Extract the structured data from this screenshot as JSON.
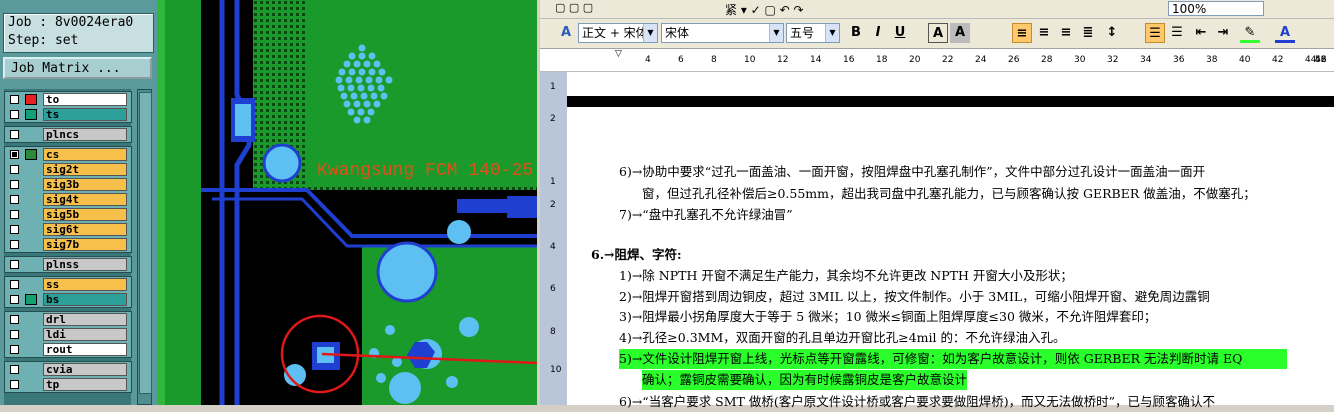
{
  "left_panel": {
    "job_label": "Job : 8v0024era0",
    "step_label": "Step: set",
    "job_matrix_button": "Job Matrix ...",
    "layers": [
      {
        "name": "to",
        "color": "#e82020",
        "selected": false
      },
      {
        "name": "ts",
        "color": "#12a07a",
        "selected": false
      },
      {
        "name": "plncs",
        "color": "",
        "selected": false
      },
      {
        "name": "cs",
        "color": "#2a8a3a",
        "selected": true
      },
      {
        "name": "sig2t",
        "color": "",
        "selected": false
      },
      {
        "name": "sig3b",
        "color": "",
        "selected": false
      },
      {
        "name": "sig4t",
        "color": "",
        "selected": false
      },
      {
        "name": "sig5b",
        "color": "",
        "selected": false
      },
      {
        "name": "sig6t",
        "color": "",
        "selected": false
      },
      {
        "name": "sig7b",
        "color": "",
        "selected": false
      },
      {
        "name": "plnss",
        "color": "",
        "selected": false
      },
      {
        "name": "ss",
        "color": "",
        "selected": false
      },
      {
        "name": "bs",
        "color": "#14a070",
        "selected": false
      },
      {
        "name": "drl",
        "color": "",
        "selected": false
      },
      {
        "name": "ldi",
        "color": "",
        "selected": false
      },
      {
        "name": "rout",
        "color": "",
        "selected": false
      },
      {
        "name": "cvia",
        "color": "",
        "selected": false
      },
      {
        "name": "tp",
        "color": "",
        "selected": false
      }
    ]
  },
  "pcb_view": {
    "silkscreen_text": "Kwangsung FCM 140-25",
    "colors": {
      "board": "#1a9a2a",
      "trace": "#1e3fd0",
      "pad": "#5ec0f2",
      "annotation": "#e01818"
    }
  },
  "word": {
    "style_combo": "正文 + 宋体",
    "font_combo": "宋体",
    "size_combo": "五号",
    "zoom": "100%",
    "ruler_numbers": [
      "4",
      "6",
      "8",
      "10",
      "12",
      "14",
      "16",
      "18",
      "20",
      "22",
      "24",
      "26",
      "28",
      "30",
      "32",
      "34",
      "36",
      "38",
      "40",
      "42",
      "44",
      "46",
      "48",
      "52"
    ],
    "vruler_numbers": [
      "1",
      "2",
      "1",
      "2",
      "4",
      "6",
      "8",
      "10"
    ],
    "paragraphs": {
      "p6_line1": "6)→协助中要求“过孔一面盖油、一面开窗，按阻焊盘中孔塞孔制作”，文件中部分过孔设计一面盖油一面开",
      "p6_line2": "窗，但过孔孔径补偿后≥0.55mm，超出我司盘中孔塞孔能力，已与顾客确认按 GERBER 做盖油，不做塞孔；",
      "p7": "7)→“盘中孔塞孔不允许绿油冒”",
      "heading": "6.→阻焊、字符:",
      "s1": "1)→除 NPTH 开窗不满足生产能力，其余均不允许更改 NPTH 开窗大小及形状；",
      "s2": "2)→阻焊开窗搭到周边铜皮，超过 3MIL 以上，按文件制作。小于 3MIL，可缩小阻焊开窗、避免周边露铜",
      "s3": "3)→阻焊最小拐角厚度大于等于 5 微米；10 微米≤铜面上阻焊厚度≤30 微米，不允许阻焊套印；",
      "s4": "4)→孔径≥0.3MM，双面开窗的孔且单边开窗比孔≥4mil 的：不允许绿油入孔。",
      "s5_line1": "5)→文件设计阻焊开窗上线，光标点等开窗露线，可修窗：如为客户故意设计，则依 GERBER 无法判断时请 EQ",
      "s5_line2": "确认；露铜皮需要确认，因为有时候露铜皮是客户故意设计",
      "s6": "6)→“当客户要求 SMT 做桥(客户原文件设计桥或客户要求要做阻焊桥)，而又无法做桥时”，已与顾客确认不"
    }
  }
}
